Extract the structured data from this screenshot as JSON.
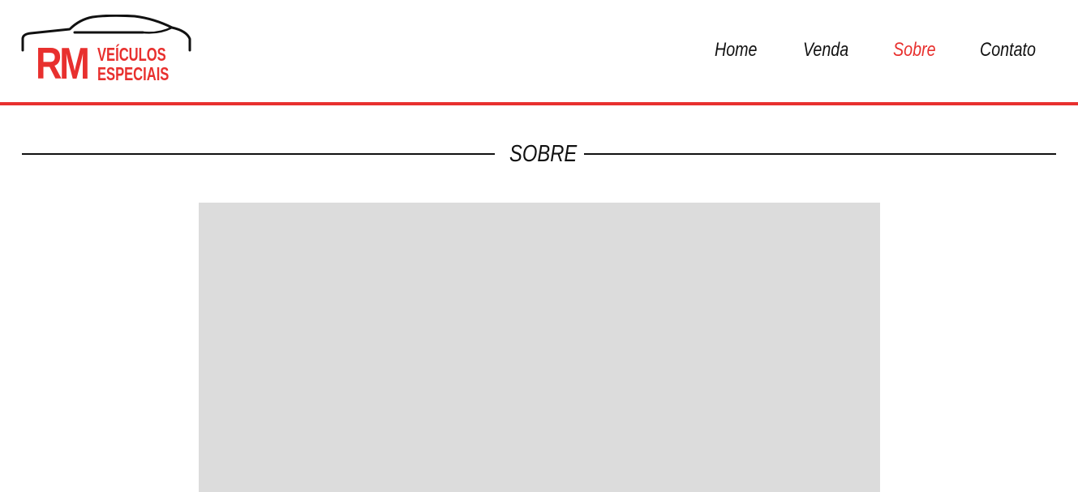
{
  "brand": {
    "logo_initials": "RM",
    "logo_line1": "VEÍCULOS",
    "logo_line2": "ESPECIAIS",
    "accent_color": "#e8302e",
    "icon": "car-outline-icon"
  },
  "nav": {
    "items": [
      {
        "label": "Home",
        "active": false
      },
      {
        "label": "Venda",
        "active": false
      },
      {
        "label": "Sobre",
        "active": true
      },
      {
        "label": "Contato",
        "active": false
      }
    ]
  },
  "main": {
    "section_title": "SOBRE",
    "placeholder_color": "#dcdcdc"
  }
}
